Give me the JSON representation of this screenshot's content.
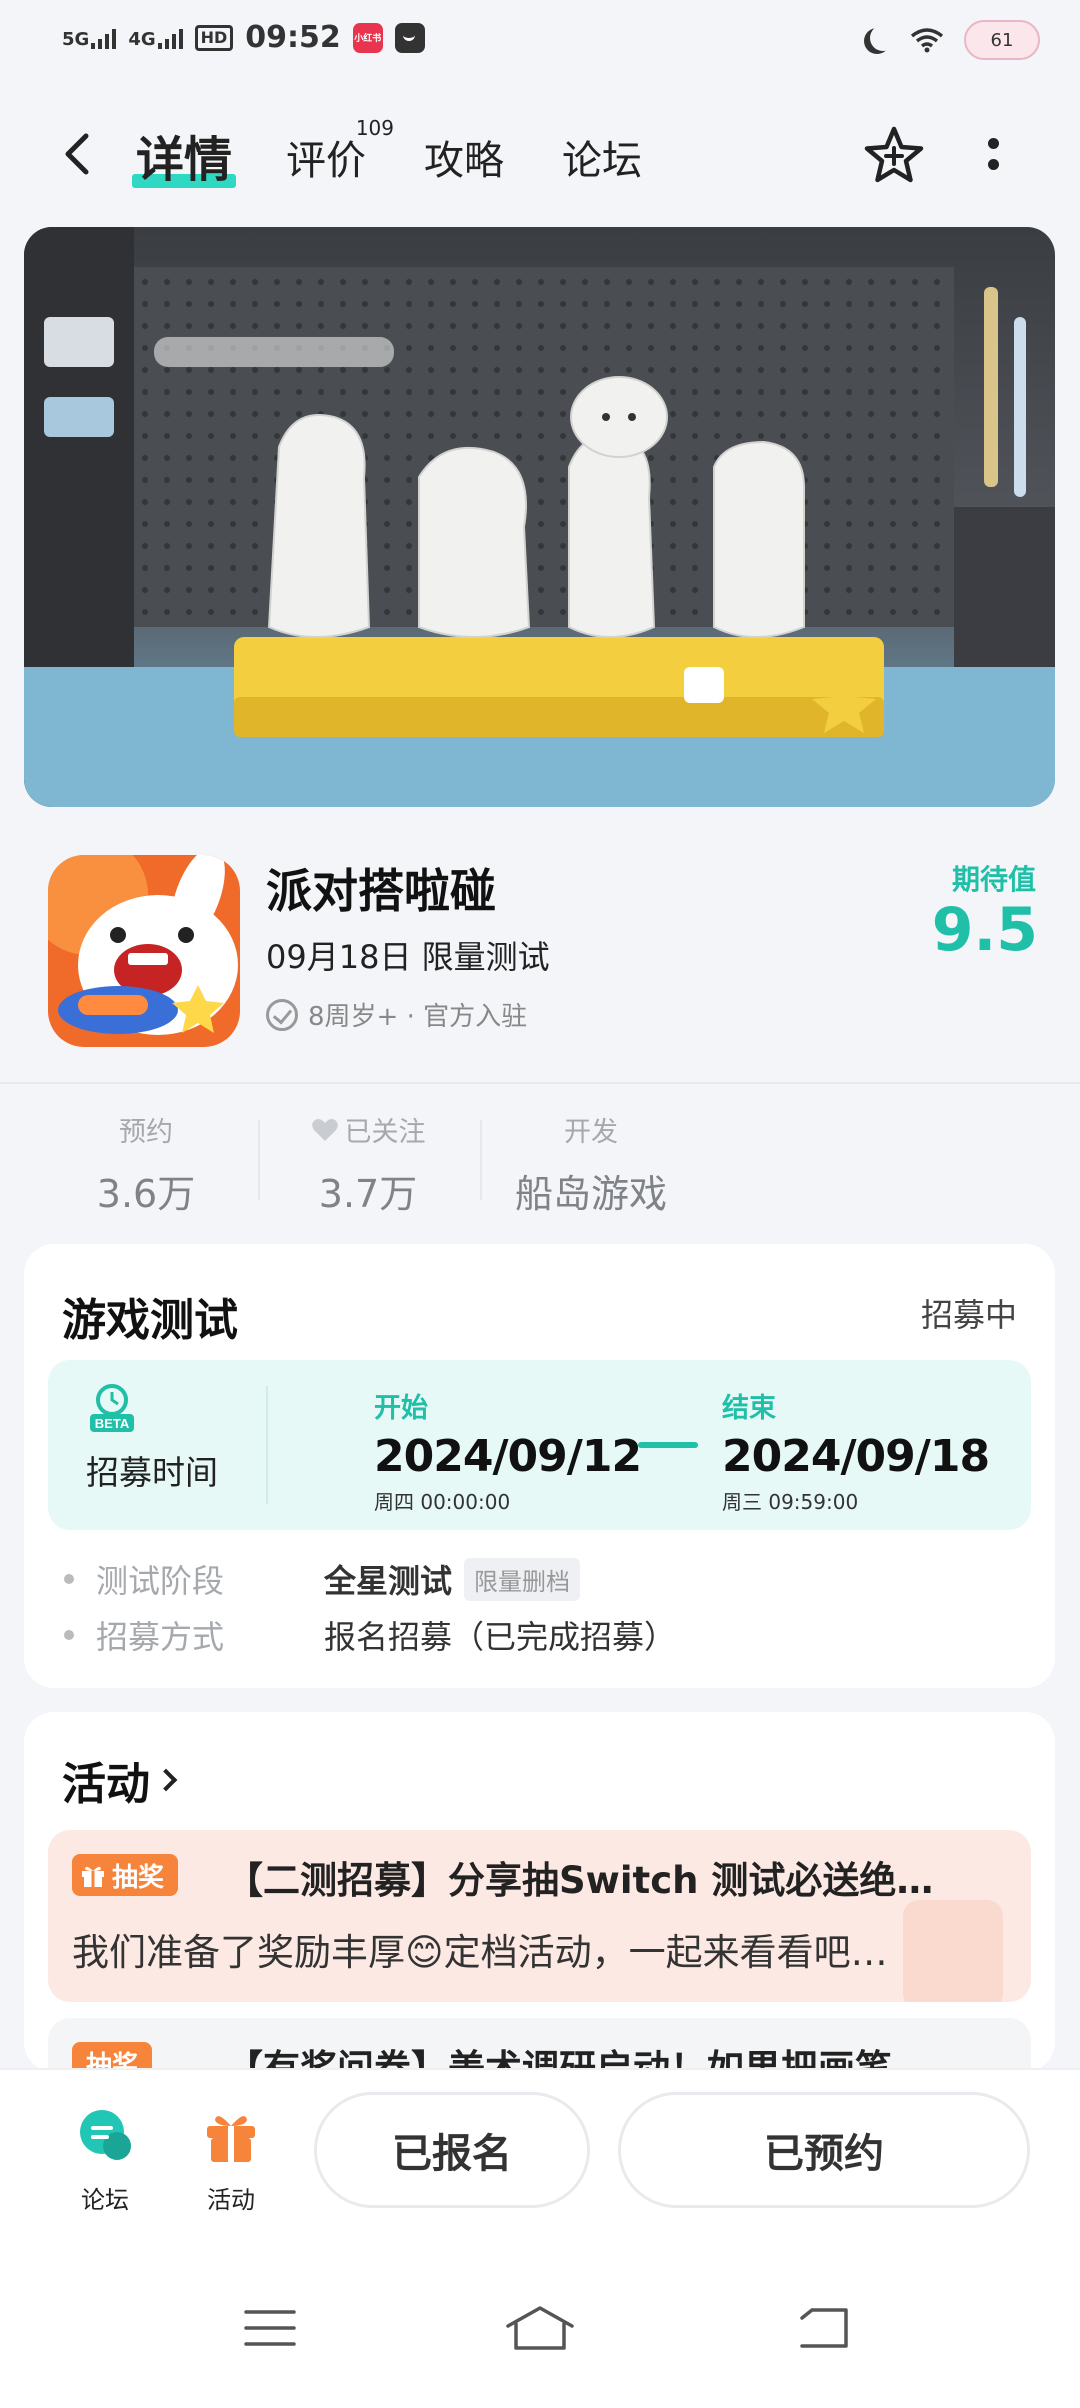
{
  "status_bar": {
    "signal1": "5G",
    "signal2": "4G",
    "hd": "HD",
    "time": "09:52",
    "app_icon_text": "小红书",
    "battery": "61"
  },
  "nav": {
    "tabs": [
      {
        "label": "详情",
        "active": true
      },
      {
        "label": "评价",
        "badge": "109"
      },
      {
        "label": "攻略"
      },
      {
        "label": "论坛"
      }
    ]
  },
  "game": {
    "title": "派对搭啦碰",
    "date_line": "09月18日  限量测试",
    "meta": "8周岁+ · 官方入驻",
    "expect_label": "期待值",
    "expect_value": "9.5"
  },
  "stats": [
    {
      "label": "预约",
      "value": "3.6万"
    },
    {
      "label": "已关注",
      "value": "3.7万"
    },
    {
      "label": "开发",
      "value": "船岛游戏"
    }
  ],
  "test_card": {
    "title": "游戏测试",
    "status": "招募中",
    "recruit_label": "招募时间",
    "beta_label": "BETA",
    "start_label": "开始",
    "start_date": "2024/09/12",
    "start_week": "周四   00:00:00",
    "end_label": "结束",
    "end_date": "2024/09/18",
    "end_week": "周三   09:59:00",
    "rows": [
      {
        "key": "测试阶段",
        "value": "全星测试",
        "tag": "限量删档"
      },
      {
        "key": "招募方式",
        "value": "报名招募（已完成招募）"
      }
    ]
  },
  "activity": {
    "title": "活动",
    "items": [
      {
        "badge": "抽奖",
        "title": "【二测招募】分享抽Switch 测试必送绝…",
        "desc": "我们准备了奖励丰厚😊定档活动，一起来看看吧…"
      },
      {
        "badge": "抽奖",
        "title": "【有奖问卷】美术调研启动！如果把画笔…"
      }
    ]
  },
  "bottom_bar": {
    "forum_label": "论坛",
    "activity_label": "活动",
    "signed_button": "已报名",
    "reserved_button": "已预约"
  },
  "colors": {
    "accent": "#1fbfa8",
    "highlight": "#2ed8c2",
    "orange": "#f6843b"
  }
}
